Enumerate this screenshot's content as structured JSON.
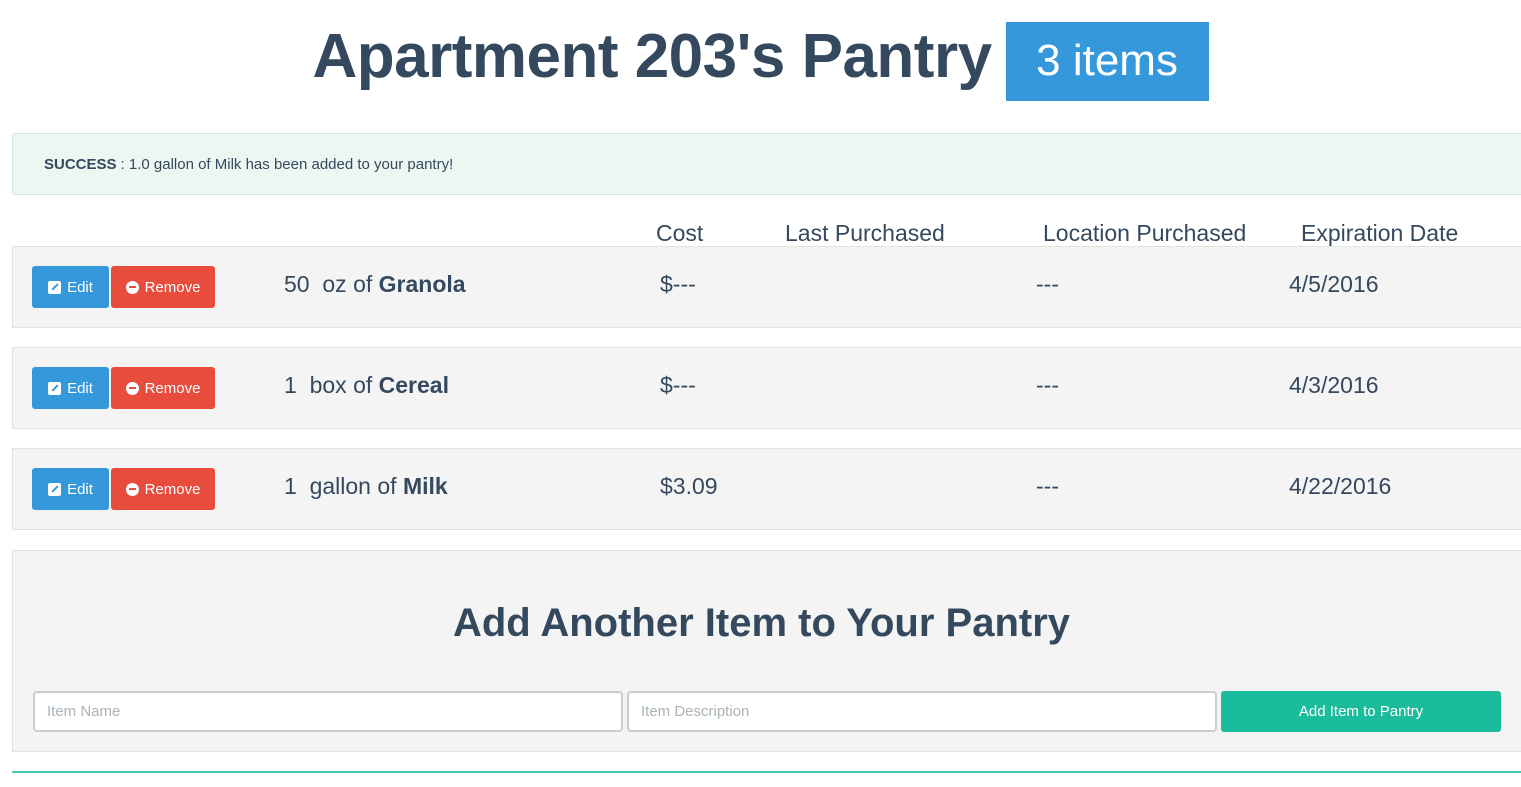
{
  "header": {
    "title": "Apartment 203's Pantry",
    "item_count": "3 items"
  },
  "alert": {
    "label": "SUCCESS",
    "message": ": 1.0 gallon of Milk has been added to your pantry!"
  },
  "columns": {
    "cost": "Cost",
    "last_purchased": "Last Purchased",
    "location_purchased": "Location Purchased",
    "expiration_date": "Expiration Date"
  },
  "actions": {
    "edit_label": "Edit",
    "remove_label": "Remove"
  },
  "items": [
    {
      "quantity": "50",
      "unit": "oz",
      "of": "of",
      "name": "Granola",
      "cost": "$---",
      "last_purchased": "",
      "location": "---",
      "expiration": "4/5/2016"
    },
    {
      "quantity": "1",
      "unit": "box",
      "of": "of",
      "name": "Cereal",
      "cost": "$---",
      "last_purchased": "",
      "location": "---",
      "expiration": "4/3/2016"
    },
    {
      "quantity": "1",
      "unit": "gallon",
      "of": "of",
      "name": "Milk",
      "cost": "$3.09",
      "last_purchased": "",
      "location": "---",
      "expiration": "4/22/2016"
    }
  ],
  "add_form": {
    "title": "Add Another Item to Your Pantry",
    "name_placeholder": "Item Name",
    "name_value": "",
    "description_placeholder": "Item Description",
    "description_value": "",
    "submit_label": "Add Item to Pantry"
  },
  "colors": {
    "primary": "#3498db",
    "danger": "#e74c3c",
    "success": "#1abc9c",
    "text": "#34495e"
  }
}
